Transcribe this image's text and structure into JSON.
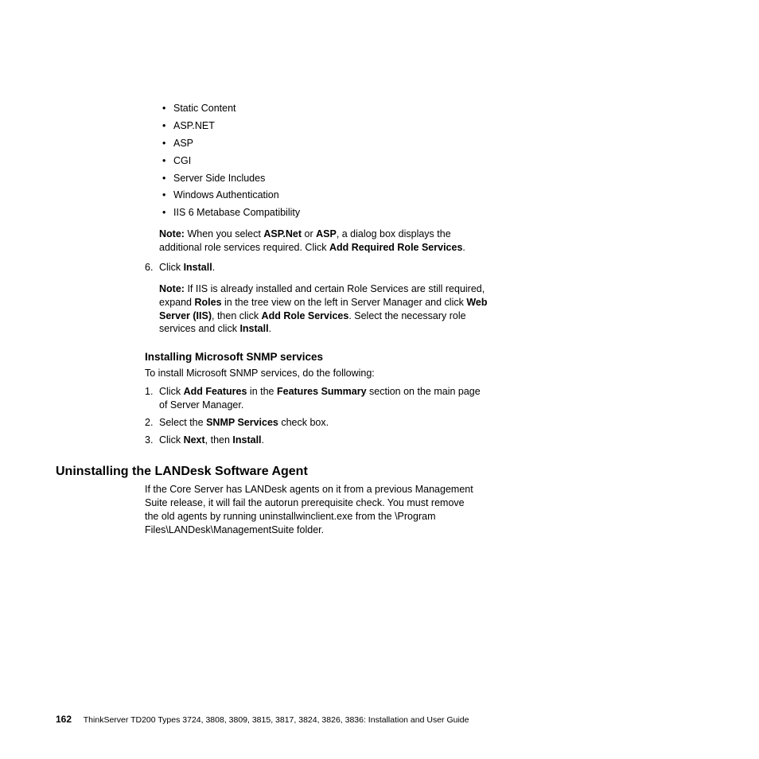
{
  "bullets": [
    "Static Content",
    "ASP.NET",
    "ASP",
    "CGI",
    "Server Side Includes",
    "Windows Authentication",
    "IIS 6 Metabase Compatibility"
  ],
  "note1": {
    "label": "Note:",
    "t1": "When you select ",
    "b1": "ASP.Net",
    "t2": " or ",
    "b2": "ASP",
    "t3": ", a dialog box displays the additional role services required. Click ",
    "b3": "Add Required Role Services",
    "t4": "."
  },
  "step6": {
    "t1": "Click ",
    "b1": "Install",
    "t2": "."
  },
  "note2": {
    "label": "Note:",
    "t1": "If IIS is already installed and certain Role Services are still required, expand ",
    "b1": "Roles",
    "t2": " in the tree view on the left in Server Manager and click ",
    "b2": "Web Server (IIS)",
    "t3": ", then click ",
    "b3": "Add Role Services",
    "t4": ". Select the necessary role services and click ",
    "b4": "Install",
    "t5": "."
  },
  "snmp": {
    "heading": "Installing Microsoft SNMP services",
    "intro": "To install Microsoft SNMP services, do the following:",
    "s1": {
      "t1": "Click ",
      "b1": "Add Features",
      "t2": " in the ",
      "b2": "Features Summary",
      "t3": " section on the main page of Server Manager."
    },
    "s2": {
      "t1": "Select the ",
      "b1": "SNMP Services",
      "t2": " check box."
    },
    "s3": {
      "t1": "Click ",
      "b1": "Next",
      "t2": ", then ",
      "b2": "Install",
      "t3": "."
    }
  },
  "uninstall": {
    "heading": "Uninstalling the LANDesk Software Agent",
    "body": "If the Core Server has LANDesk agents on it from a previous Management Suite release, it will fail the autorun prerequisite check. You must remove the old agents by running uninstallwinclient.exe from the \\Program Files\\LANDesk\\ManagementSuite folder."
  },
  "footer": {
    "page": "162",
    "text": "ThinkServer TD200 Types 3724, 3808, 3809, 3815, 3817, 3824, 3826, 3836: Installation and User Guide"
  }
}
